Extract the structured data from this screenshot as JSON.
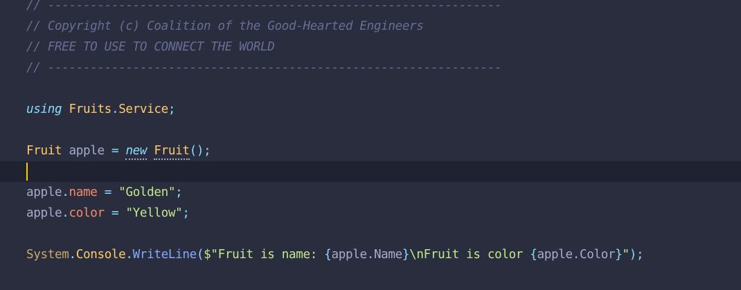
{
  "editor": {
    "lines": [
      {
        "tokens": [
          {
            "t": "// ----------------------------------------------------------------",
            "c": "comment"
          }
        ]
      },
      {
        "tokens": [
          {
            "t": "// Copyright (c) Coalition of the Good-Hearted Engineers",
            "c": "comment"
          }
        ]
      },
      {
        "tokens": [
          {
            "t": "// FREE TO USE TO CONNECT THE WORLD",
            "c": "comment"
          }
        ]
      },
      {
        "tokens": [
          {
            "t": "// ----------------------------------------------------------------",
            "c": "comment"
          }
        ]
      },
      {
        "tokens": []
      },
      {
        "tokens": [
          {
            "t": "using",
            "c": "kw"
          },
          {
            "t": " ",
            "c": "var"
          },
          {
            "t": "Fruits",
            "c": "ns"
          },
          {
            "t": ".",
            "c": "punc"
          },
          {
            "t": "Service",
            "c": "ns"
          },
          {
            "t": ";",
            "c": "punc"
          }
        ]
      },
      {
        "tokens": []
      },
      {
        "tokens": [
          {
            "t": "Fruit",
            "c": "type"
          },
          {
            "t": " ",
            "c": "var"
          },
          {
            "t": "apple",
            "c": "var"
          },
          {
            "t": " ",
            "c": "var"
          },
          {
            "t": "=",
            "c": "punc"
          },
          {
            "t": " ",
            "c": "var"
          },
          {
            "t": "new",
            "c": "kw",
            "hint": true
          },
          {
            "t": " ",
            "c": "var"
          },
          {
            "t": "Fruit",
            "c": "type",
            "hint": true
          },
          {
            "t": "();",
            "c": "punc"
          }
        ]
      },
      {
        "tokens": [],
        "current": true
      },
      {
        "tokens": [
          {
            "t": "apple",
            "c": "var"
          },
          {
            "t": ".",
            "c": "punc"
          },
          {
            "t": "name",
            "c": "prop"
          },
          {
            "t": " ",
            "c": "var"
          },
          {
            "t": "=",
            "c": "punc"
          },
          {
            "t": " ",
            "c": "var"
          },
          {
            "t": "\"Golden\"",
            "c": "str"
          },
          {
            "t": ";",
            "c": "punc"
          }
        ]
      },
      {
        "tokens": [
          {
            "t": "apple",
            "c": "var"
          },
          {
            "t": ".",
            "c": "punc"
          },
          {
            "t": "color",
            "c": "prop"
          },
          {
            "t": " ",
            "c": "var"
          },
          {
            "t": "=",
            "c": "punc"
          },
          {
            "t": " ",
            "c": "var"
          },
          {
            "t": "\"Yellow\"",
            "c": "str"
          },
          {
            "t": ";",
            "c": "punc"
          }
        ]
      },
      {
        "tokens": []
      },
      {
        "tokens": [
          {
            "t": "System",
            "c": "sys"
          },
          {
            "t": ".",
            "c": "punc"
          },
          {
            "t": "Console",
            "c": "type"
          },
          {
            "t": ".",
            "c": "punc"
          },
          {
            "t": "WriteLine",
            "c": "fn"
          },
          {
            "t": "(",
            "c": "punc"
          },
          {
            "t": "$\"Fruit is name: ",
            "c": "str"
          },
          {
            "t": "{",
            "c": "punc"
          },
          {
            "t": "apple.Name",
            "c": "interp"
          },
          {
            "t": "}",
            "c": "punc"
          },
          {
            "t": "\\nFruit is color ",
            "c": "str"
          },
          {
            "t": "{",
            "c": "punc"
          },
          {
            "t": "apple.Color",
            "c": "interp"
          },
          {
            "t": "}",
            "c": "punc"
          },
          {
            "t": "\"",
            "c": "str"
          },
          {
            "t": ");",
            "c": "punc"
          }
        ]
      }
    ]
  },
  "colors": {
    "background": "#292d3e",
    "current_line": "#1f2230",
    "caret": "#ffcc00",
    "comment": "#676e95",
    "keyword": "#89ddff",
    "type": "#ffcb6b",
    "string": "#c3e88d",
    "property": "#f78c6c",
    "function": "#82aaff"
  }
}
